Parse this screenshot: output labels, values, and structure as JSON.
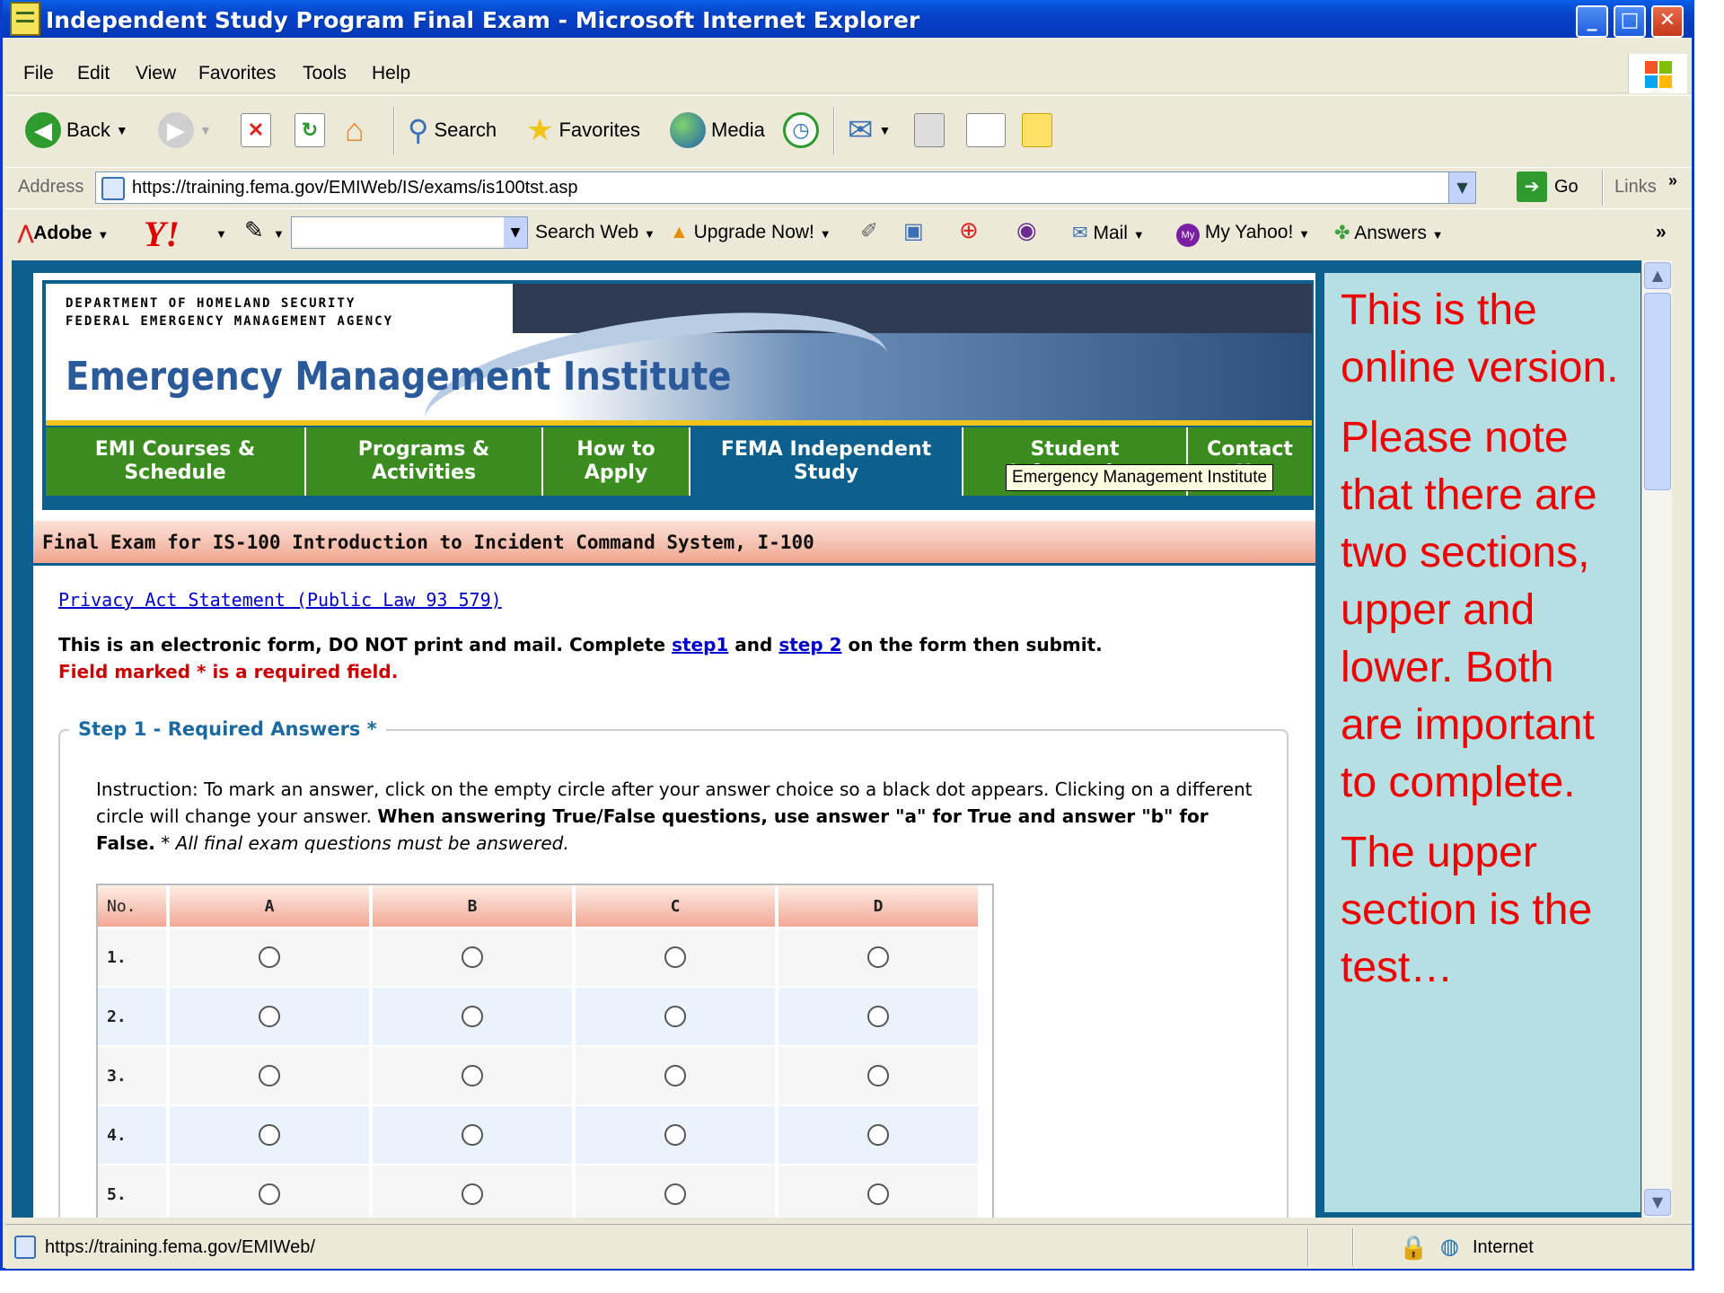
{
  "window": {
    "title": "Independent Study Program Final Exam - Microsoft Internet Explorer"
  },
  "menu": [
    "File",
    "Edit",
    "View",
    "Favorites",
    "Tools",
    "Help"
  ],
  "toolbar": {
    "back_label": "Back",
    "search_label": "Search",
    "favorites_label": "Favorites",
    "media_label": "Media"
  },
  "address": {
    "label": "Address",
    "url": "https://training.fema.gov/EMIWeb/IS/exams/is100tst.asp",
    "go_label": "Go",
    "links_label": "Links"
  },
  "yahoo_toolbar": {
    "adobe_label": "Adobe",
    "yahoo_label": "Y!",
    "search_input": "",
    "search_web_label": "Search Web",
    "upgrade_label": "Upgrade Now!",
    "mail_label": "Mail",
    "my_yahoo_label": "My Yahoo!",
    "answers_label": "Answers"
  },
  "header": {
    "dept_line1": "DEPARTMENT OF HOMELAND SECURITY",
    "dept_line2": "FEDERAL EMERGENCY MANAGEMENT AGENCY",
    "site_title": "Emergency Management Institute"
  },
  "nav": [
    {
      "label": "EMI Courses & Schedule",
      "active": false
    },
    {
      "label": "Programs & Activities",
      "active": false
    },
    {
      "label": "How to Apply",
      "active": false
    },
    {
      "label": "FEMA Independent Study",
      "active": true
    },
    {
      "label": "Student Information",
      "active": false
    },
    {
      "label": "Contact Us",
      "active": false
    }
  ],
  "tooltip": "Emergency Management Institute",
  "exam": {
    "title": "Final Exam for IS-100 Introduction to Incident Command System, I-100",
    "privacy_link": "Privacy Act Statement (Public Law 93 579)",
    "instr_prefix": "This is an electronic form, DO NOT print and mail. Complete ",
    "step1_link": "step1",
    "instr_and": " and ",
    "step2_link": "step 2",
    "instr_suffix": " on the form then submit.",
    "required_note": "Field marked * is a required field.",
    "step1_legend": "Step 1 - Required Answers *",
    "instruction_plain": "Instruction: To mark an answer, click on the empty circle after your answer choice so a black dot appears. Clicking on a different circle will change your answer. ",
    "instruction_bold": "When answering True/False questions, use answer \"a\" for True and answer \"b\" for False.",
    "instruction_italic": " * All final exam questions must be answered.",
    "table_headers": [
      "No.",
      "A",
      "B",
      "C",
      "D"
    ],
    "questions": [
      "1.",
      "2.",
      "3.",
      "4.",
      "5."
    ]
  },
  "note": {
    "p1": "This is the online version.",
    "p2": "Please note that there are two sections, upper and lower. Both are important to complete.",
    "p3": "The upper section is the test…"
  },
  "status": {
    "url": "https://training.fema.gov/EMIWeb/",
    "zone": "Internet"
  }
}
